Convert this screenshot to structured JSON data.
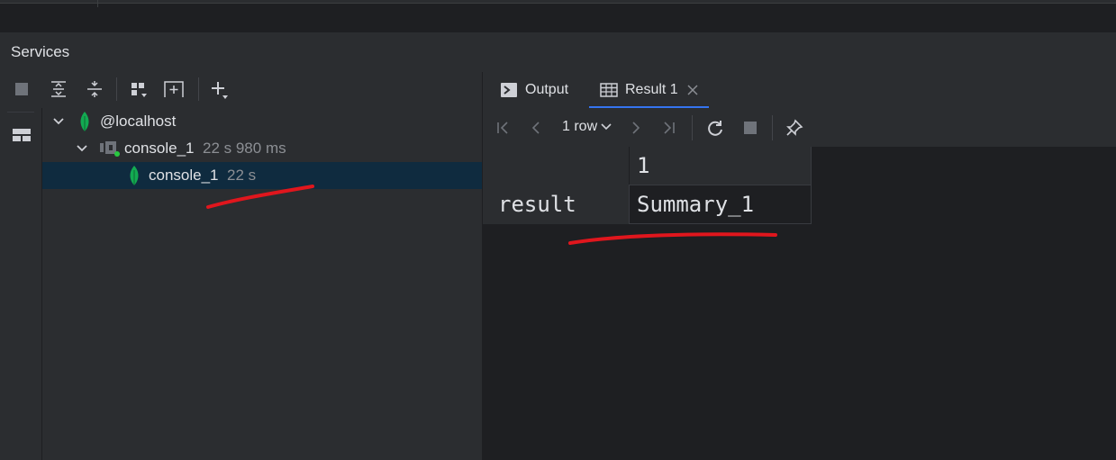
{
  "panel": {
    "title": "Services"
  },
  "toolbar": {
    "icons": [
      "stop-icon",
      "expand-all-icon",
      "collapse-all-icon",
      "group-icon",
      "new-tab-icon",
      "add-icon"
    ]
  },
  "tree": {
    "items": [
      {
        "label": "@localhost",
        "meta": "",
        "icon": "mongodb-leaf-icon"
      },
      {
        "label": "console_1",
        "meta": "22 s 980 ms",
        "icon": "console-icon"
      },
      {
        "label": "console_1",
        "meta": "22 s",
        "icon": "mongodb-leaf-icon"
      }
    ]
  },
  "tabs": [
    {
      "label": "Output",
      "icon": "output-icon"
    },
    {
      "label": "Result 1",
      "icon": "table-icon",
      "closable": true
    }
  ],
  "result_toolbar": {
    "rows_label": "1 row"
  },
  "grid": {
    "column_header": "1",
    "row_header": "result",
    "value": "Summary_1"
  },
  "colors": {
    "accent": "#3574f0",
    "selection": "#0f2b3f",
    "annotation": "#e0161d",
    "leaf_green": "#13aa52"
  }
}
